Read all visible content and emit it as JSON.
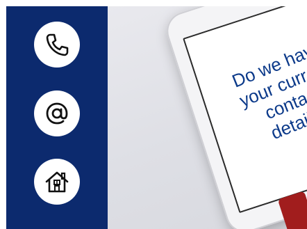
{
  "side_panel": {
    "color": "#0c2a6e",
    "icons": [
      {
        "name": "phone-icon"
      },
      {
        "name": "at-sign-icon"
      },
      {
        "name": "home-icon"
      }
    ]
  },
  "tablet_message": {
    "lines": [
      "Do we have",
      "your current",
      "contact",
      "details?"
    ],
    "text_color": "#0c3a8a"
  }
}
